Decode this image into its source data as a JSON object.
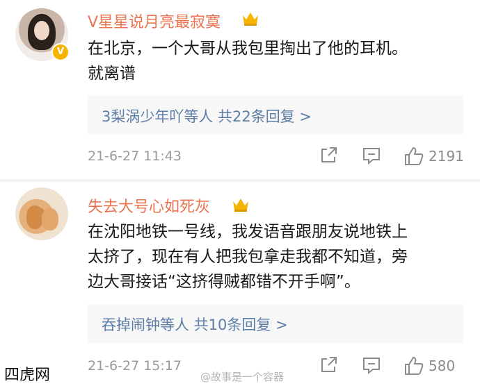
{
  "comments": [
    {
      "username": "V星星说月亮最寂寞",
      "text_line1": "在北京，一个大哥从我包里掏出了他的耳机。",
      "text_line2": "就离谱",
      "replies": "3梨涡少年吖等人 共22条回复 >",
      "time": "21-6-27 11:43",
      "likes": "2191",
      "verified": "V"
    },
    {
      "username": "失去大号心如死灰",
      "text_line1": "在沈阳地铁一号线，我发语音跟朋友说地铁上",
      "text_line2": "太挤了，现在有人把我包拿走我都不知道，旁",
      "text_line3": "边大哥接话“这挤得贼都错不开手啊”。",
      "replies": "吞掉闹钟等人 共10条回复 >",
      "time": "21-6-27 15:17",
      "likes": "580"
    }
  ],
  "watermark": "@故事是一个容器",
  "site": "四虎网",
  "colors": {
    "username": "#eb7350",
    "link": "#5b7da8",
    "meta": "#9a9a9a",
    "crown": "#f5b400"
  }
}
